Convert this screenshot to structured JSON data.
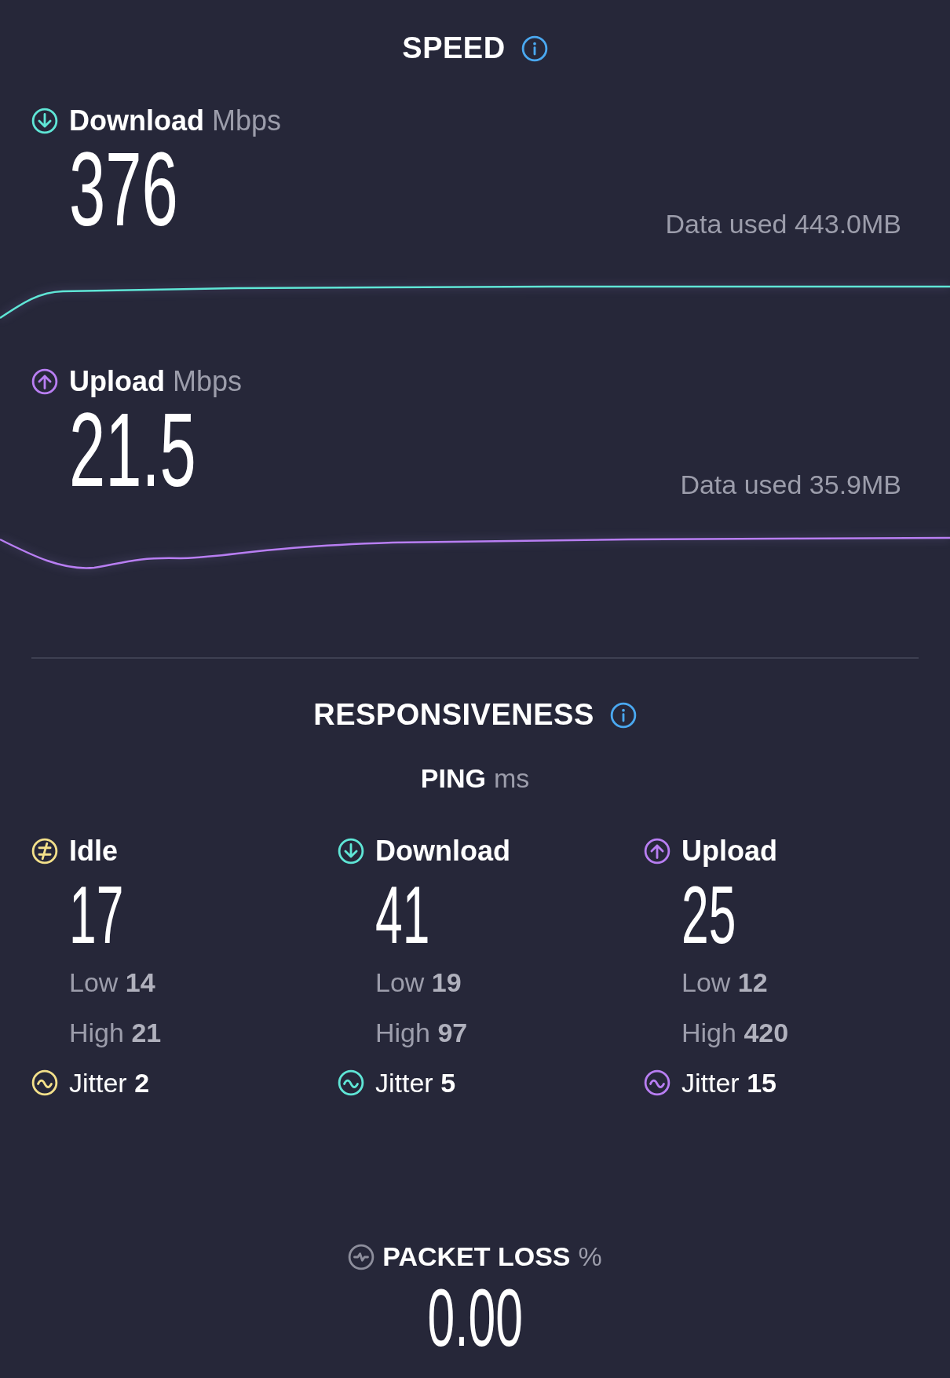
{
  "speed": {
    "title": "SPEED",
    "tests": [
      {
        "kind": "download",
        "label": "Download",
        "unit": "Mbps",
        "value": "376",
        "data_used": "Data used 443.0MB"
      },
      {
        "kind": "upload",
        "label": "Upload",
        "unit": "Mbps",
        "value": "21.5",
        "data_used": "Data used 35.9MB"
      }
    ]
  },
  "responsiveness": {
    "title": "RESPONSIVENESS",
    "ping_label": "PING",
    "ping_unit": "ms",
    "columns": [
      {
        "kind": "idle",
        "label": "Idle",
        "value": "17",
        "low": "Low **14**",
        "high": "High **21**",
        "jitter": "Jitter **2**"
      },
      {
        "kind": "download",
        "label": "Download",
        "value": "41",
        "low": "Low **19**",
        "high": "High **97**",
        "jitter": "Jitter **5**"
      },
      {
        "kind": "upload",
        "label": "Upload",
        "value": "25",
        "low": "Low **12**",
        "high": "High **420**",
        "jitter": "Jitter **15**"
      }
    ]
  },
  "packet_loss": {
    "label": "PACKET LOSS",
    "unit": "%",
    "value": "0.00"
  }
}
